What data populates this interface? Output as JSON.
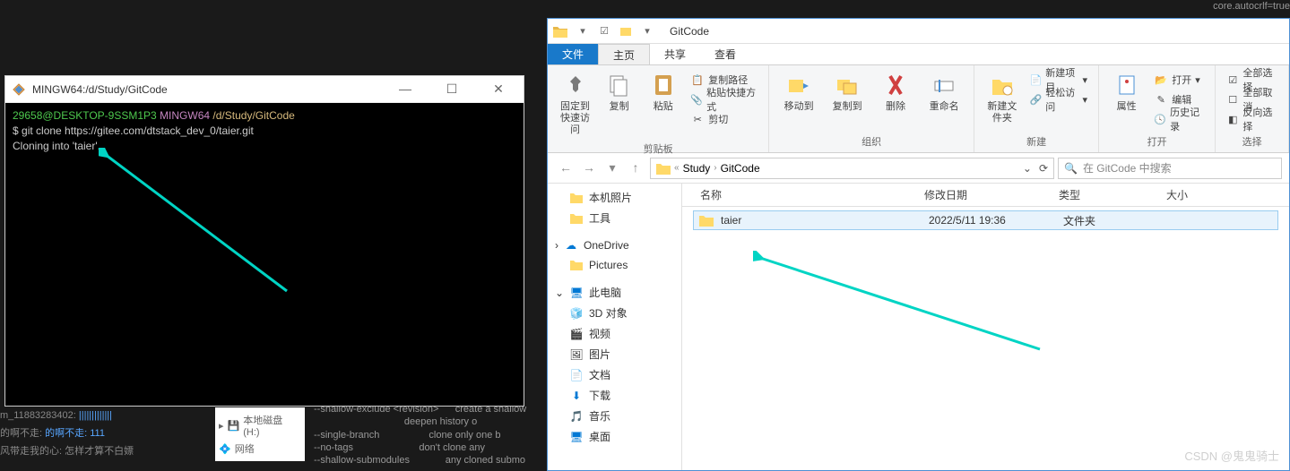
{
  "terminal": {
    "title": "MINGW64:/d/Study/GitCode",
    "user": "29658@DESKTOP-9SSM1P3",
    "host": "MINGW64",
    "path": "/d/Study/GitCode",
    "prompt": "$",
    "command": "git clone https://gitee.com/dtstack_dev_0/taier.git",
    "output": "Cloning into 'taier'..."
  },
  "explorer": {
    "title": "GitCode",
    "tabs": {
      "file": "文件",
      "home": "主页",
      "share": "共享",
      "view": "查看"
    },
    "ribbon": {
      "clipboard": {
        "label": "剪贴板",
        "pin": "固定到快速访问",
        "copy": "复制",
        "paste": "粘贴",
        "copypath": "复制路径",
        "pasteshortcut": "粘贴快捷方式",
        "cut": "剪切"
      },
      "organize": {
        "label": "组织",
        "moveto": "移动到",
        "copyto": "复制到",
        "delete": "删除",
        "rename": "重命名"
      },
      "new": {
        "label": "新建",
        "newfolder": "新建文件夹",
        "newitem": "新建项目",
        "easyaccess": "轻松访问"
      },
      "open": {
        "label": "打开",
        "properties": "属性",
        "open": "打开",
        "edit": "编辑",
        "history": "历史记录"
      },
      "select": {
        "label": "选择",
        "all": "全部选择",
        "none": "全部取消",
        "invert": "反向选择"
      }
    },
    "nav": {
      "crumbs": [
        "Study",
        "GitCode"
      ],
      "search_placeholder": "在 GitCode 中搜索"
    },
    "sidebar": {
      "items": [
        {
          "label": "本机照片",
          "type": "folder"
        },
        {
          "label": "工具",
          "type": "folder"
        },
        {
          "label": "OneDrive",
          "type": "onedrive",
          "section": true
        },
        {
          "label": "Pictures",
          "type": "folder"
        },
        {
          "label": "此电脑",
          "type": "pc",
          "section": true
        },
        {
          "label": "3D 对象",
          "type": "3d"
        },
        {
          "label": "视频",
          "type": "video"
        },
        {
          "label": "图片",
          "type": "pic"
        },
        {
          "label": "文档",
          "type": "doc"
        },
        {
          "label": "下载",
          "type": "dl"
        },
        {
          "label": "音乐",
          "type": "music"
        },
        {
          "label": "桌面",
          "type": "desktop"
        }
      ]
    },
    "columns": {
      "name": "名称",
      "date": "修改日期",
      "type": "类型",
      "size": "大小"
    },
    "files": [
      {
        "name": "taier",
        "date": "2022/5/11 19:36",
        "type": "文件夹",
        "size": ""
      }
    ]
  },
  "bg_panel": {
    "disk": "本地磁盘 (H:)",
    "net": "网络"
  },
  "bg_terminal_lines": [
    "--shallow-exclude <revision>",
    "",
    "--single-branch",
    "--no-tags",
    "--shallow-submodules"
  ],
  "bg_terminal_right": [
    "create a shallow",
    "deepen history o",
    "clone only one b",
    "don't clone any",
    "any cloned submo"
  ],
  "bg_term2_lines": [
    "core.autocrlf=true"
  ],
  "bg_left": {
    "l1": "的啊不走: 111",
    "l2": "风带走我的心: 怎样才算不白嫖"
  },
  "watermark": "CSDN @鬼鬼骑士"
}
